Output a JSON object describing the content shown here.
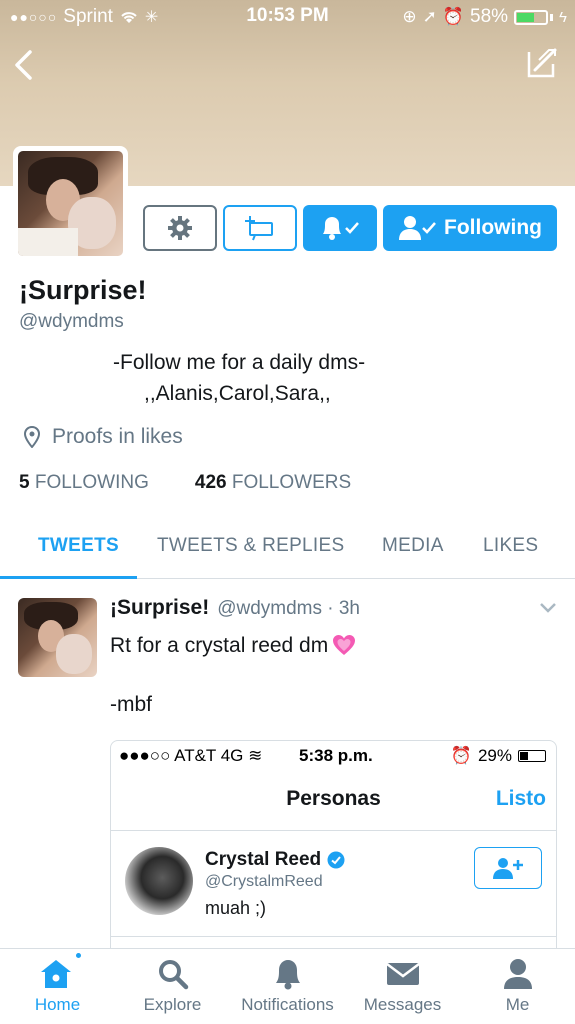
{
  "status_bar": {
    "carrier": "Sprint",
    "time": "10:53 PM",
    "battery": "58%",
    "battery_level": 0.58
  },
  "profile": {
    "display_name": "¡Surprise!",
    "handle": "@wdymdms",
    "bio_line1": "-Follow me for a daily dms-",
    "bio_line2": ",,Alanis,Carol,Sara,,",
    "location": "Proofs in likes",
    "following_count": "5",
    "following_label": "FOLLOWING",
    "followers_count": "426",
    "followers_label": "FOLLOWERS",
    "following_button": "Following"
  },
  "tabs": [
    {
      "label": "TWEETS"
    },
    {
      "label": "TWEETS & REPLIES"
    },
    {
      "label": "MEDIA"
    },
    {
      "label": "LIKES"
    }
  ],
  "tweet": {
    "name": "¡Surprise!",
    "meta": "@wdymdms · 3h",
    "text": "Rt for a crystal reed dm",
    "sign": "-mbf",
    "embed": {
      "status_left": "●●●○○ AT&T 4G",
      "status_time": "5:38 p.m.",
      "status_battery": "29%",
      "battery_level": 0.29,
      "title": "Personas",
      "done": "Listo",
      "user_name": "Crystal Reed",
      "user_handle": "@CrystalmReed",
      "user_bio": "muah ;)"
    }
  },
  "bottom_nav": [
    {
      "label": "Home"
    },
    {
      "label": "Explore"
    },
    {
      "label": "Notifications"
    },
    {
      "label": "Messages"
    },
    {
      "label": "Me"
    }
  ],
  "colors": {
    "accent": "#1da1f2",
    "muted": "#657786",
    "battery_green": "#4cd964"
  }
}
